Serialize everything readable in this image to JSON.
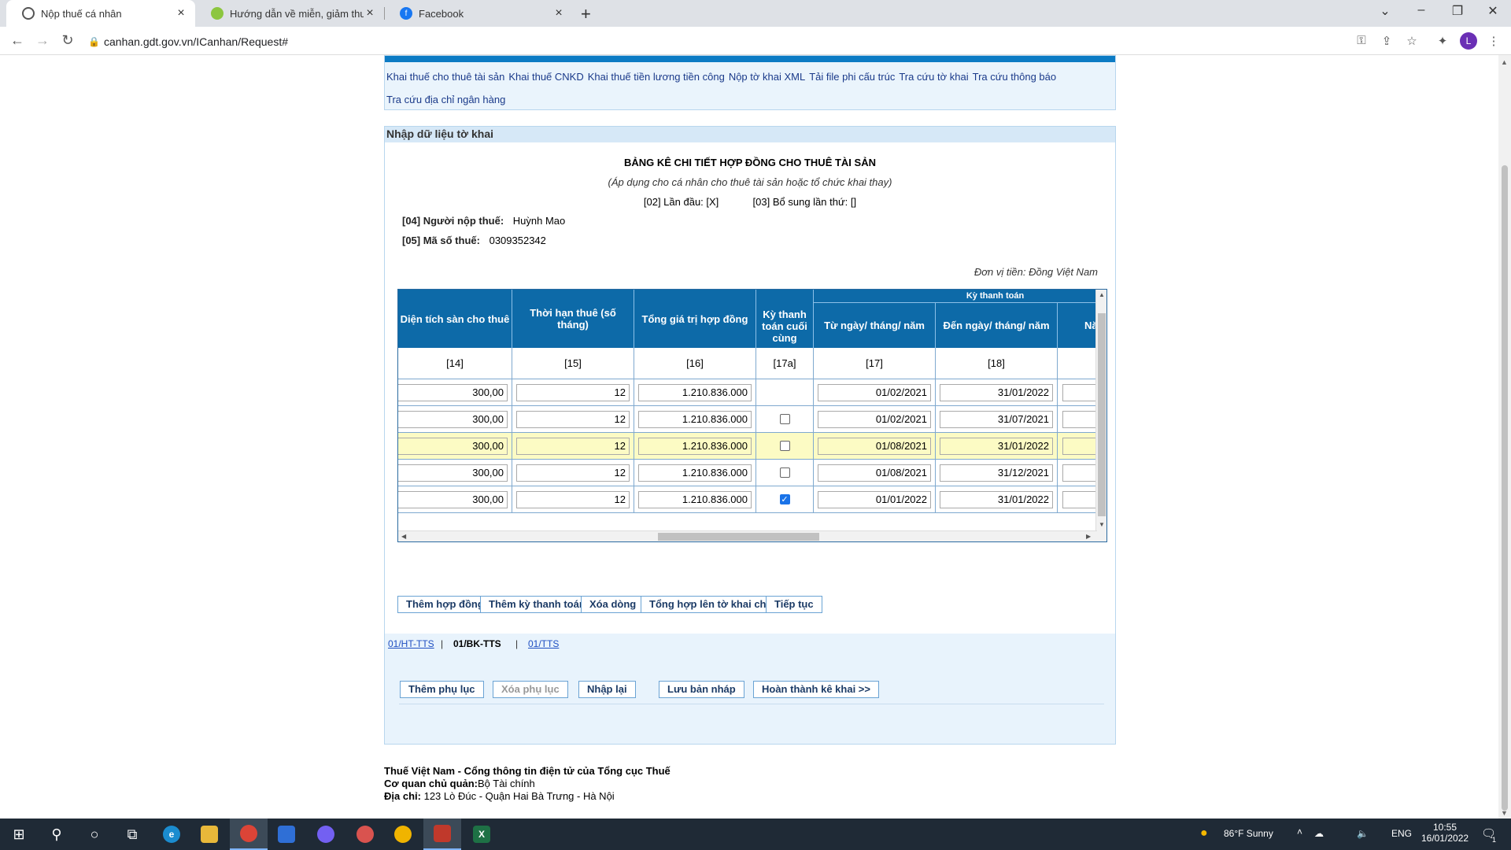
{
  "browser": {
    "tabs": [
      {
        "title": "Nộp thuế cá nhân",
        "active": true
      },
      {
        "title": "Hướng dẫn về miễn, giảm thuế c",
        "active": false
      },
      {
        "title": "Facebook",
        "active": false
      }
    ],
    "new_tab": "+",
    "url": "canhan.gdt.gov.vn/ICanhan/Request#",
    "profile_initial": "L"
  },
  "menu": {
    "links": [
      "Khai thuế cho thuê tài sản",
      "Khai thuế CNKD",
      "Khai thuế tiền lương tiền công",
      "Nộp tờ khai XML",
      "Tải file phi cấu trúc",
      "Tra cứu tờ khai",
      "Tra cứu thông báo",
      "Tra cứu địa chỉ ngân hàng"
    ]
  },
  "panel": {
    "header": "Nhập dữ liệu tờ khai",
    "title": "BẢNG KÊ CHI TIẾT HỢP ĐỒNG CHO THUÊ TÀI SẢN",
    "subtitle": "(Áp dụng cho cá nhân cho thuê tài sản hoặc tổ chức khai thay)",
    "first_time": "[02] Lần đầu: [X]",
    "supplement": "[03] Bổ sung lần thứ: []",
    "taxpayer_label": "[04] Người nộp thuế:",
    "taxpayer_value": "Huỳnh Mao",
    "taxcode_label": "[05] Mã số thuế:",
    "taxcode_value": "0309352342",
    "currency_unit": "Đơn vị tiền: Đồng Việt Nam"
  },
  "table": {
    "group_header": "Kỳ thanh toán",
    "headers": [
      "Diện tích sàn cho thuê",
      "Thời hạn thuê (số tháng)",
      "Tổng giá trị hợp đồng",
      "Kỳ thanh toán cuối cùng",
      "Từ ngày/ tháng/ năm",
      "Đến ngày/ tháng/ năm",
      "Nă"
    ],
    "codes": [
      "[14]",
      "[15]",
      "[16]",
      "[17a]",
      "[17]",
      "[18]",
      ""
    ],
    "rows": [
      {
        "area": "300,00",
        "months": "12",
        "value": "1.210.836.000",
        "last": "none",
        "from": "01/02/2021",
        "to": "31/01/2022",
        "highlight": false
      },
      {
        "area": "300,00",
        "months": "12",
        "value": "1.210.836.000",
        "last": "unchecked",
        "from": "01/02/2021",
        "to": "31/07/2021",
        "highlight": false
      },
      {
        "area": "300,00",
        "months": "12",
        "value": "1.210.836.000",
        "last": "unchecked",
        "from": "01/08/2021",
        "to": "31/01/2022",
        "highlight": true
      },
      {
        "area": "300,00",
        "months": "12",
        "value": "1.210.836.000",
        "last": "unchecked",
        "from": "01/08/2021",
        "to": "31/12/2021",
        "highlight": false
      },
      {
        "area": "300,00",
        "months": "12",
        "value": "1.210.836.000",
        "last": "checked",
        "from": "01/01/2022",
        "to": "31/01/2022",
        "highlight": false
      }
    ]
  },
  "actions": {
    "add_contract": "Thêm hợp đồng",
    "add_period": "Thêm kỳ thanh toán",
    "delete_row": "Xóa dòng",
    "summarize": "Tổng hợp lên tờ khai chính",
    "continue": "Tiếp tục"
  },
  "annex": {
    "link1": "01/HT-TTS",
    "current": "01/BK-TTS",
    "link3": "01/TTS",
    "sep": "|",
    "add_annex": "Thêm phụ lục",
    "delete_annex": "Xóa phụ lục",
    "reset": "Nhập lại",
    "save_draft": "Lưu bản nháp",
    "finish": "Hoàn thành kê khai >>"
  },
  "footer": {
    "title": "Thuế Việt Nam - Cổng thông tin điện tử của Tổng cục Thuế",
    "agency_label": "Cơ quan chủ quản:",
    "agency_value": "Bộ Tài chính",
    "address_label": "Địa chỉ:",
    "address_value": "123 Lò Đúc - Quận Hai Bà Trưng - Hà Nội"
  },
  "taskbar": {
    "weather": "86°F  Sunny",
    "lang": "ENG",
    "time": "10:55",
    "date": "16/01/2022",
    "notif_count": "1"
  },
  "colors": {
    "header_blue": "#0d6aa8",
    "highlight_yellow": "#fcfbc4",
    "link_blue": "#1f4fc2"
  }
}
